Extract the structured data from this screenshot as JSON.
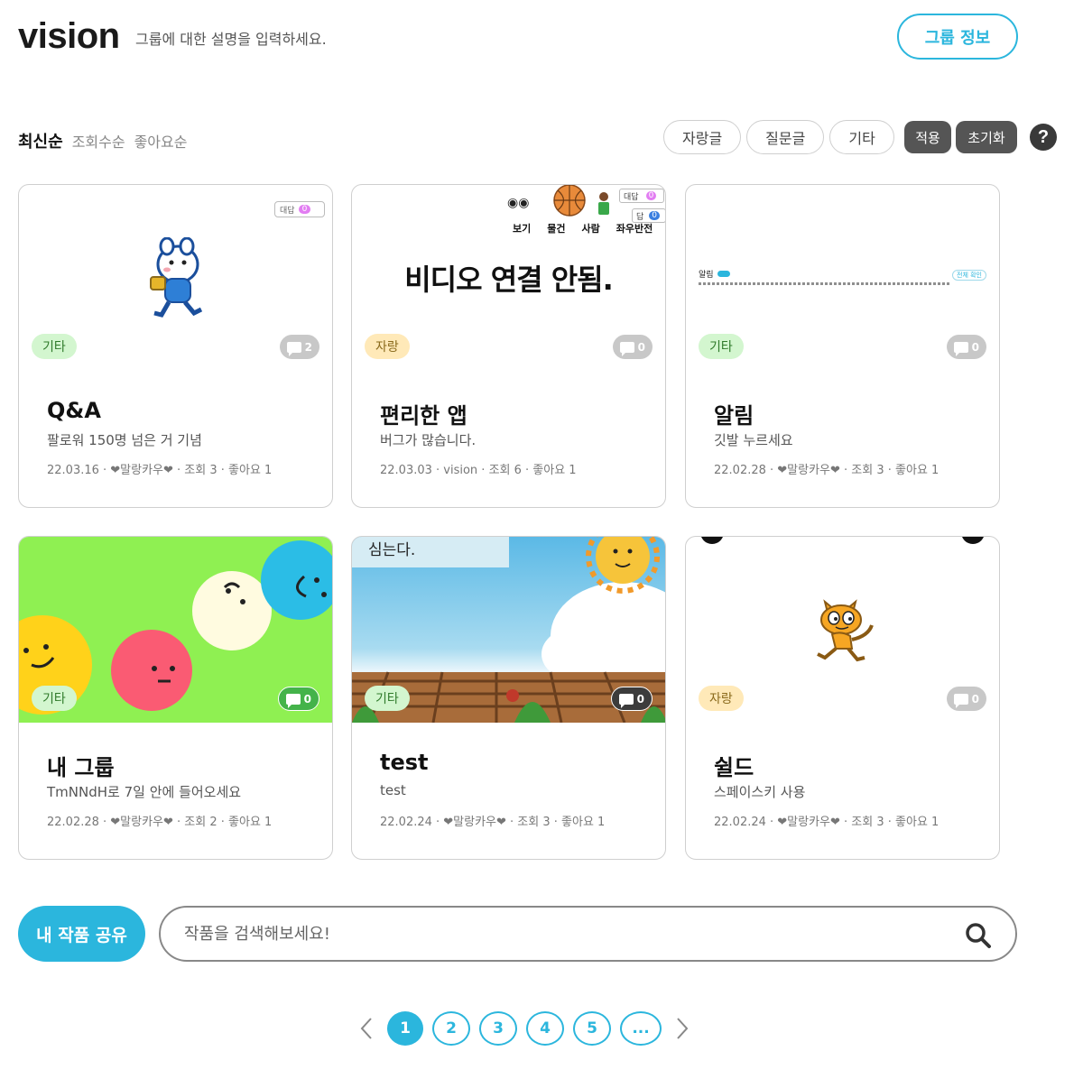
{
  "header": {
    "title": "vision",
    "description": "그룹에 대한 설명을 입력하세요.",
    "group_info_label": "그룹 정보"
  },
  "sort": {
    "active": "최신순",
    "options": [
      "조회수순",
      "좋아요순"
    ]
  },
  "filters": {
    "chips": [
      "자랑글",
      "질문글",
      "기타"
    ],
    "apply_label": "적용",
    "reset_label": "초기화",
    "help_label": "?"
  },
  "cards": [
    {
      "category": "기타",
      "comments": "2",
      "title": "Q&A",
      "subtitle": "팔로워 150명 넘은 거 기념",
      "meta": "22.03.16 · ❤말랑카우❤ · 조회 3 · 좋아요 1",
      "thumb": {
        "badge_text": "대답",
        "badge_count": "0"
      }
    },
    {
      "category": "자랑",
      "comments": "0",
      "title": "편리한 앱",
      "subtitle": "버그가 많습니다.",
      "meta": "22.03.03 · vision · 조회 6 · 좋아요 1",
      "thumb": {
        "headline": "비디오 연결 안됨.",
        "labels": [
          "보기",
          "물건",
          "사람",
          "좌우반전"
        ],
        "badge_text": "대답",
        "badge_text2": "답",
        "badge_count": "0"
      }
    },
    {
      "category": "기타",
      "comments": "0",
      "title": "알림",
      "subtitle": "깃발 누르세요",
      "meta": "22.02.28 · ❤말랑카우❤ · 조회 3 · 좋아요 1",
      "thumb": {
        "small_title": "알림",
        "small_badge": "전체 확인"
      }
    },
    {
      "category": "기타",
      "comments": "0",
      "title": "내 그룹",
      "subtitle": "TmNNdH로 7일 안에 들어오세요",
      "meta": "22.02.28 · ❤말랑카우❤ · 조회 2 · 좋아요 1",
      "thumb": {}
    },
    {
      "category": "기타",
      "comments": "0",
      "title": "test",
      "subtitle": "test",
      "meta": "22.02.24 · ❤말랑카우❤ · 조회 3 · 좋아요 1",
      "thumb": {
        "caption": "심는다."
      }
    },
    {
      "category": "자랑",
      "comments": "0",
      "title": "쉴드",
      "subtitle": "스페이스키 사용",
      "meta": "22.02.24 · ❤말랑카우❤ · 조회 3 · 좋아요 1",
      "thumb": {}
    }
  ],
  "bottom": {
    "share_label": "내 작품 공유",
    "search_placeholder": "작품을 검색해보세요!"
  },
  "pagination": {
    "pages": [
      "1",
      "2",
      "3",
      "4",
      "5"
    ],
    "current": "1",
    "more": "..."
  },
  "colors": {
    "accent": "#2bb6dd",
    "etc_tag_bg": "#d3f6cf",
    "brag_tag_bg": "#ffe9b8",
    "dark_button": "#555555"
  }
}
